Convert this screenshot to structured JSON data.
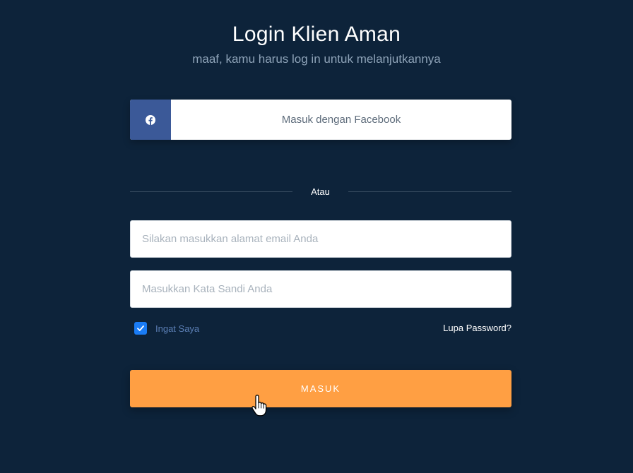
{
  "header": {
    "title": "Login Klien Aman",
    "subtitle": "maaf, kamu harus log in untuk melanjutkannya"
  },
  "social": {
    "facebook_label": "Masuk dengan Facebook",
    "icon": "facebook-icon",
    "brand_color": "#3b5998"
  },
  "divider": {
    "text": "Atau"
  },
  "form": {
    "email": {
      "value": "",
      "placeholder": "Silakan masukkan alamat email Anda"
    },
    "password": {
      "value": "",
      "placeholder": "Masukkan Kata Sandi Anda"
    },
    "remember_label": "Ingat Saya",
    "remember_checked": true,
    "forgot_label": "Lupa Password?",
    "submit_label": "MASUK"
  },
  "colors": {
    "background": "#0d233a",
    "accent": "#ff9f43",
    "checkbox": "#1a7cf5"
  }
}
